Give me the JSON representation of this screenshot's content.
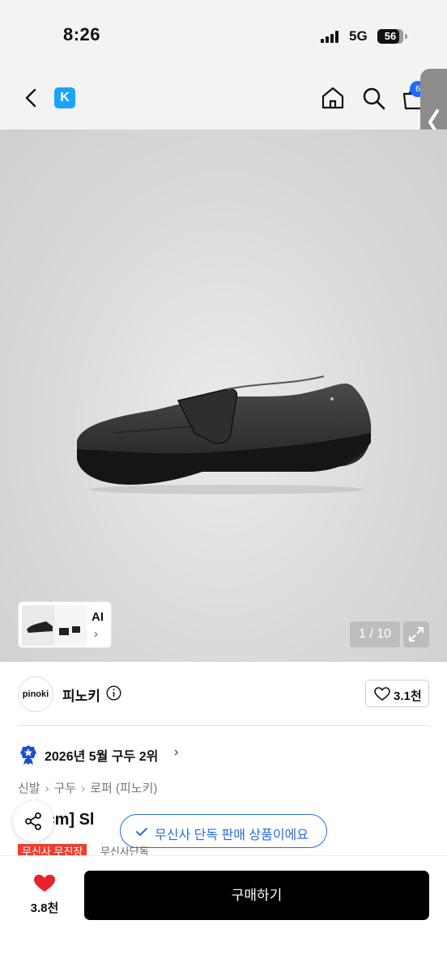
{
  "status": {
    "time": "8:26",
    "network": "5G",
    "battery": "56"
  },
  "header": {
    "logo": "K",
    "cart_count": "6",
    "icons": [
      "back-icon",
      "home-icon",
      "search-icon",
      "cart-icon"
    ]
  },
  "gallery": {
    "counter": "1 / 10",
    "thumb_label": "AI",
    "thumb_chevron": "›"
  },
  "brand": {
    "logo_text": "pinoki",
    "name": "피노키",
    "likes": "3.1천"
  },
  "ranking": {
    "text": "2026년 5월 구두 2위",
    "chevron": "›"
  },
  "breadcrumb": [
    "신발",
    "구두",
    "로퍼 (피노키)"
  ],
  "breadcrumb_sep": "›",
  "product": {
    "title": "[3.5cm] Sl",
    "tag_red": "무신사 무진장",
    "tag_gray": "무신사단독"
  },
  "toast": {
    "text": "무신사 단독 판매 상품이에요"
  },
  "bottom": {
    "wish_count": "3.8천",
    "buy_label": "구매하기"
  },
  "colors": {
    "accent": "#1a6bff",
    "toast": "#2b6bd8",
    "heart": "#e8212d",
    "tag": "#ef3d2e"
  }
}
